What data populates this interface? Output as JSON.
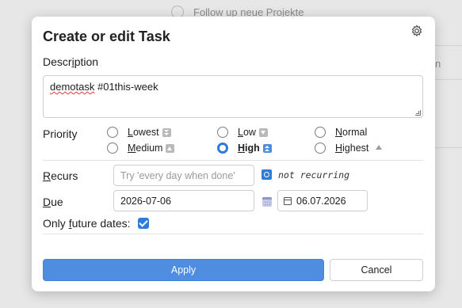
{
  "background": {
    "task_row": "Follow up neue Projekte",
    "right_fragment": "n"
  },
  "dialog": {
    "title": "Create or edit Task",
    "settings_icon": "gear-icon",
    "description": {
      "label_pre": "Descr",
      "label_u": "i",
      "label_post": "ption",
      "value_tag": "demotask",
      "value_rest": " #01this-week"
    },
    "priority": {
      "label": "Priority",
      "options": [
        {
          "pre": "",
          "u": "L",
          "post": "owest",
          "icon": "double-down-icon",
          "checked": false
        },
        {
          "pre": "",
          "u": "L",
          "post": "ow",
          "icon": "down-icon",
          "checked": false
        },
        {
          "pre": "",
          "u": "N",
          "post": "ormal",
          "icon": "",
          "checked": false
        },
        {
          "pre": "",
          "u": "M",
          "post": "edium",
          "icon": "up-icon",
          "checked": false
        },
        {
          "pre": "",
          "u": "H",
          "post": "igh",
          "icon": "double-up-icon",
          "checked": true
        },
        {
          "pre": "",
          "u": "H",
          "post": "ighest",
          "icon": "highest-icon",
          "checked": false
        }
      ]
    },
    "recurs": {
      "label_u": "R",
      "label_post": "ecurs",
      "placeholder": "Try 'every day when done'",
      "status": "not recurring"
    },
    "due": {
      "label_u": "D",
      "label_post": "ue",
      "value": "2026-07-06",
      "picker_value": "06.07.2026"
    },
    "future": {
      "label_pre": "Only ",
      "label_u": "f",
      "label_post": "uture dates:",
      "checked": true
    },
    "buttons": {
      "apply": "Apply",
      "cancel": "Cancel"
    }
  },
  "colors": {
    "accent": "#2f7bd9",
    "apply_bg": "#4f8de0"
  }
}
